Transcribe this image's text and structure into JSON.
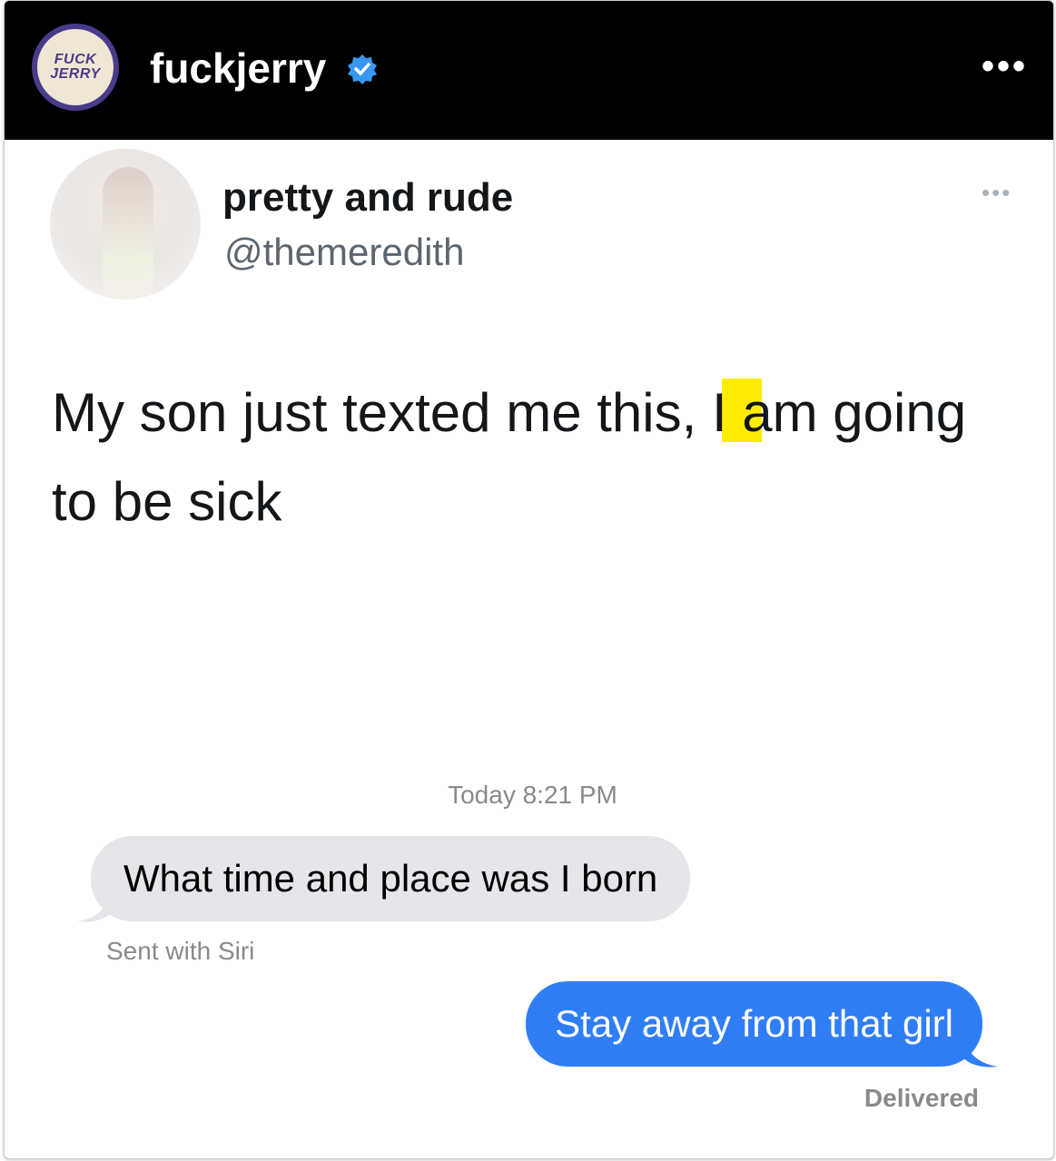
{
  "post_header": {
    "brand_logo_text": "FUCK JERRY",
    "username": "fuckjerry",
    "verified_icon": "verified-badge-icon",
    "more_icon": "more-horizontal-icon"
  },
  "tweet": {
    "display_name": "pretty and rude",
    "handle": "@themeredith",
    "text": "My son just texted me this, I am going to be sick",
    "highlight_color": "#ffec00",
    "more_icon": "more-horizontal-icon"
  },
  "messages": {
    "timestamp": "Today 8:21 PM",
    "incoming_text": "What time and place was I born",
    "incoming_note": "Sent with Siri",
    "outgoing_text": "Stay away from that girl",
    "outgoing_status": "Delivered",
    "incoming_color": "#e5e5ea",
    "outgoing_color": "#2f7ef6"
  },
  "colors": {
    "header_bg": "#000000",
    "verified_blue": "#3897f0",
    "brand_purple": "#4a3a8a"
  }
}
